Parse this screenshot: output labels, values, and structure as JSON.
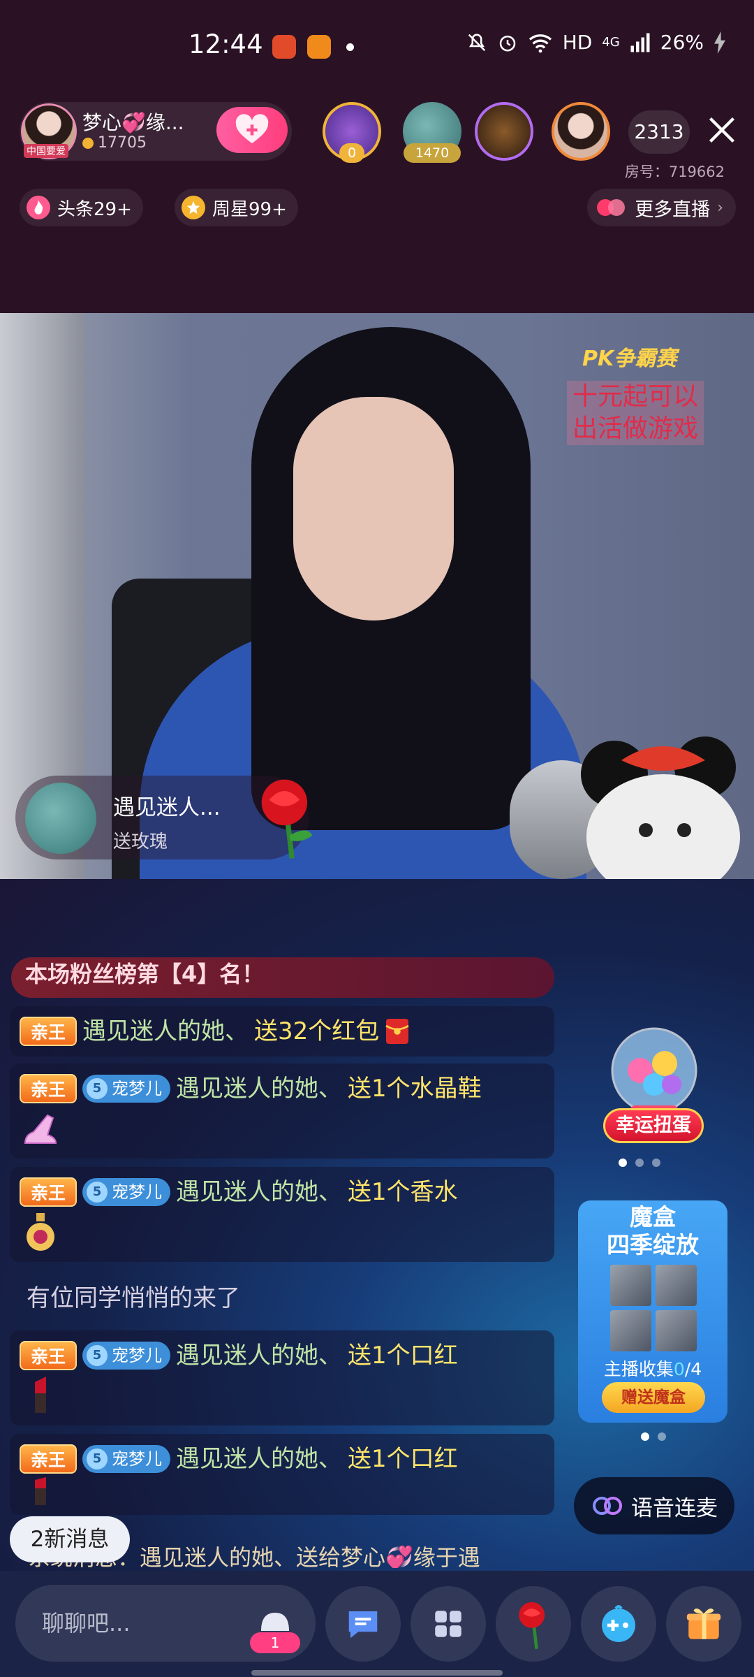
{
  "status_bar": {
    "time": "12:44",
    "network": "HD",
    "signal": "4G",
    "battery": "26%"
  },
  "host": {
    "name": "梦心💞缘...",
    "followers": "17705",
    "avatar_caption": "中国要爱"
  },
  "viewers": [
    {
      "badge": "0",
      "accent": "#f0b43a"
    },
    {
      "badge": "1470",
      "accent": "#c8a43c"
    }
  ],
  "online_count": "2313",
  "room_number": "房号：719662",
  "chips": {
    "headline": "头条29+",
    "weekly_star": "周星99+",
    "more_live": "更多直播"
  },
  "video": {
    "pk_tag": "PK争霸赛",
    "promo_text": "十元起可以出活做游戏"
  },
  "gift_toast": {
    "user": "遇见迷人...",
    "action": "送玫瑰"
  },
  "chat": {
    "fan_rank": "本场粉丝榜第【4】名！",
    "king_badge": "亲王",
    "pet_badge": "宠梦儿",
    "pet_level": "5",
    "messages": [
      {
        "user": "遇见迷人的她、",
        "action": "送32个红包",
        "icon": "red-envelope-icon",
        "pet": false
      },
      {
        "user": "遇见迷人的她、",
        "action": "送1个水晶鞋",
        "icon": "crystal-shoe-icon",
        "pet": true
      },
      {
        "user": "遇见迷人的她、",
        "action": "送1个香水",
        "icon": "perfume-icon",
        "pet": true
      },
      {
        "user": "遇见迷人的她、",
        "action": "送1个口红",
        "icon": "lipstick-icon",
        "pet": true
      },
      {
        "user": "遇见迷人的她、",
        "action": "送1个口红",
        "icon": "lipstick-icon",
        "pet": true
      }
    ],
    "system_message": "有位同学悄悄的来了",
    "cut_off_message": "系统消息：遇见迷人的她、送给梦心💞缘于遇"
  },
  "side": {
    "lottery_label": "幸运扭蛋",
    "magic_box_title_1": "魔盒",
    "magic_box_title_2": "四季绽放",
    "collect_label": "主播收集",
    "collect_current": "0",
    "collect_total": "/4",
    "gift_box_button": "赠送魔盒"
  },
  "voice_button": "语音连麦",
  "new_messages": "2新消息",
  "bottom": {
    "input_placeholder": "聊聊吧...",
    "input_badge": "1"
  },
  "colors": {
    "top_bg": "#2a1224",
    "follow_pink": "#ff4f8f",
    "gift_yellow": "#ffe46a",
    "user_green": "#bfe3a6"
  }
}
